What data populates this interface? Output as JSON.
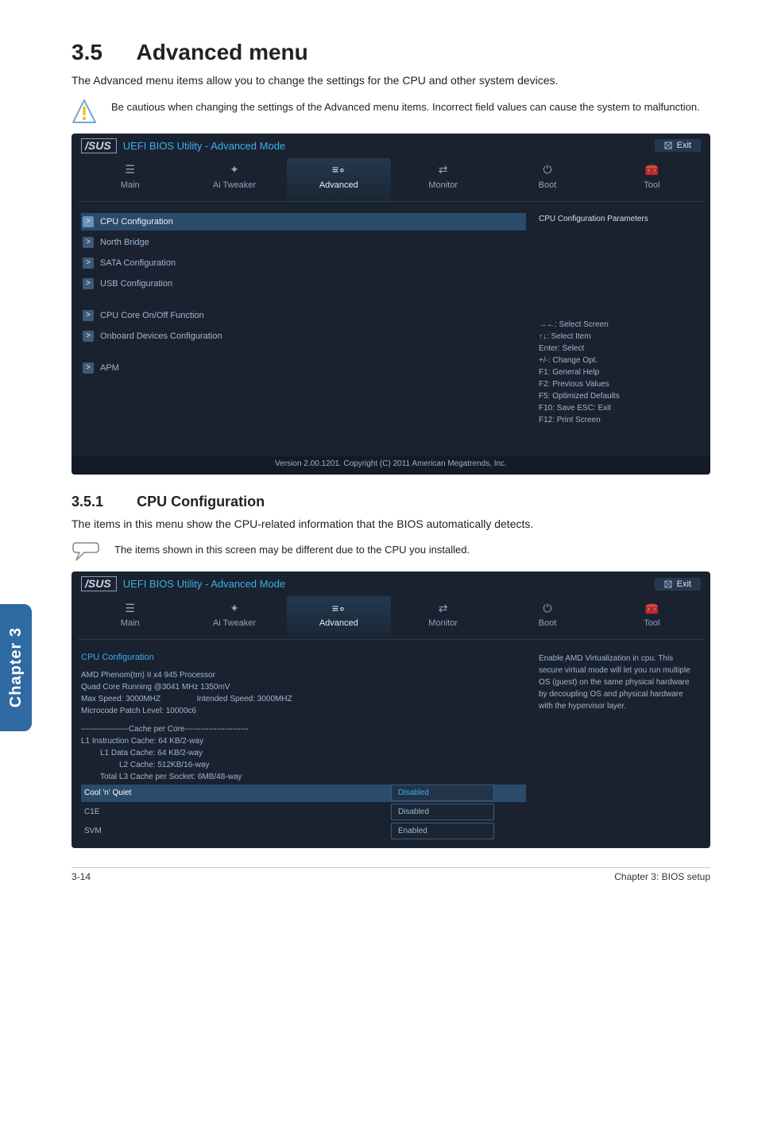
{
  "section": {
    "number": "3.5",
    "title": "Advanced menu",
    "intro": "The Advanced menu items allow you to change the settings for the CPU and other system devices.",
    "caution": "Be cautious when changing the settings of the Advanced menu items. Incorrect field values can cause the system to malfunction."
  },
  "bios1": {
    "brand": "/SUS",
    "title": "UEFI BIOS Utility - Advanced Mode",
    "exit": "Exit",
    "tabs": {
      "main": "Main",
      "ai": "Ai Tweaker",
      "adv": "Advanced",
      "mon": "Monitor",
      "boot": "Boot",
      "tool": "Tool"
    },
    "items": {
      "cpu": "CPU Configuration",
      "north": "North Bridge",
      "sata": "SATA Configuration",
      "usb": "USB Configuration",
      "core": "CPU Core On/Off Function",
      "onboard": "Onboard Devices Configuration",
      "apm": "APM"
    },
    "help_title": "CPU Configuration Parameters",
    "keys": {
      "k1": "→←:  Select Screen",
      "k2": "↑↓:  Select Item",
      "k3": "Enter:  Select",
      "k4": "+/-:  Change Opt.",
      "k5": "F1:  General Help",
      "k6": "F2:  Previous Values",
      "k7": "F5:  Optimized Defaults",
      "k8": "F10:  Save   ESC:  Exit",
      "k9": "F12:  Print Screen"
    },
    "version": "Version  2.00.1201.   Copyright  (C)  2011  American  Megatrends,  Inc."
  },
  "subsection": {
    "number": "3.5.1",
    "title": "CPU Configuration",
    "intro": "The items in this menu show the CPU-related information that the BIOS automatically detects.",
    "note": "The items shown in this screen may be different due to the CPU you installed."
  },
  "bios2": {
    "section_title": "CPU Configuration",
    "lines": {
      "l1": "AMD Phenom(tm) II x4 945 Processor",
      "l2": "Quad Core Running @3041 MHz  1350mV",
      "l3a": "Max Speed: 3000MHZ",
      "l3b": "Intended Speed: 3000MHZ",
      "l4": "Microcode Patch Level: 10000c6",
      "cache_hdr": "------------------Cache per Core------------------------",
      "c1": "L1 Instruction Cache: 64 KB/2-way",
      "c2": "L1 Data Cache: 64 KB/2-way",
      "c3": "L2 Cache: 512KB/16-way",
      "c4": "Total L3 Cache per Socket: 6MB/48-way"
    },
    "rows": {
      "cnq": {
        "label": "Cool 'n' Quiet",
        "val": "Disabled"
      },
      "c1e": {
        "label": "C1E",
        "val": "Disabled"
      },
      "svm": {
        "label": "SVM",
        "val": "Enabled"
      }
    },
    "help": "Enable AMD Virtualization in cpu. This secure virtual mode will let you run multiple OS (guest) on the same physical hardware by decoupling OS and physical hardware with the hypervisor layer."
  },
  "sidebar": "Chapter 3",
  "footer": {
    "left": "3-14",
    "right": "Chapter 3: BIOS setup"
  }
}
